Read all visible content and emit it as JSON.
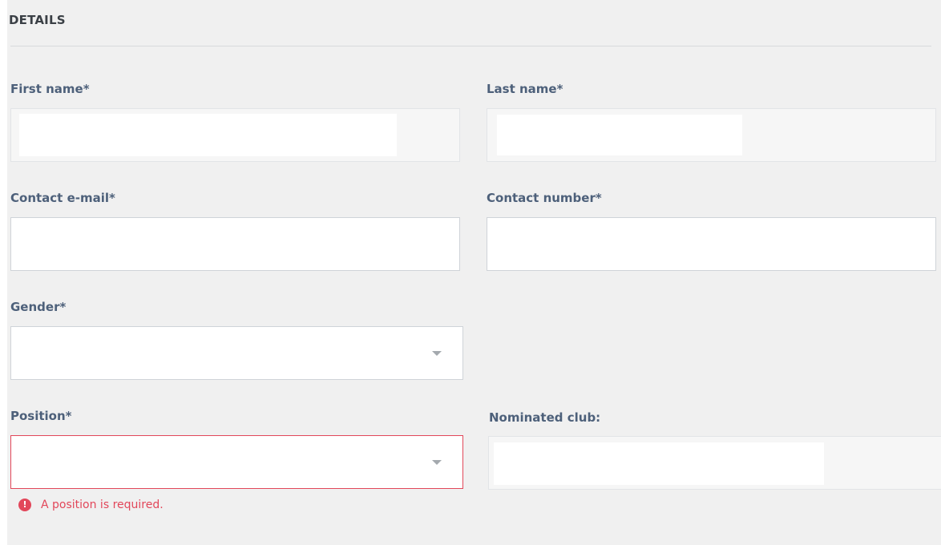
{
  "section": {
    "title": "DETAILS"
  },
  "fields": {
    "first_name": {
      "label": "First name*",
      "value": ""
    },
    "last_name": {
      "label": "Last name*",
      "value": ""
    },
    "contact_email": {
      "label": "Contact e-mail*",
      "value": ""
    },
    "contact_number": {
      "label": "Contact number*",
      "value": ""
    },
    "gender": {
      "label": "Gender*",
      "selected": ""
    },
    "position": {
      "label": "Position*",
      "selected": "",
      "error": "A position is required."
    },
    "nominated_club": {
      "label": "Nominated club:",
      "value": ""
    }
  },
  "icons": {
    "dropdown": "chevron-down-icon",
    "error": "error-icon"
  },
  "colors": {
    "label": "#4d607a",
    "error": "#e2475a",
    "background": "#f0f0f0"
  }
}
